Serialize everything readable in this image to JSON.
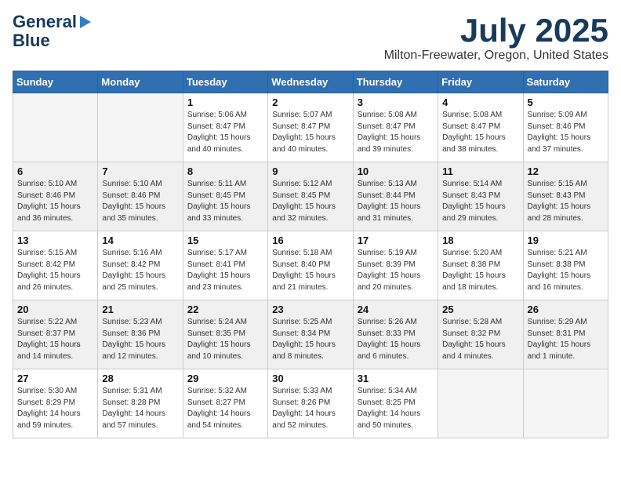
{
  "header": {
    "logo_line1": "General",
    "logo_line2": "Blue",
    "month": "July 2025",
    "location": "Milton-Freewater, Oregon, United States"
  },
  "weekdays": [
    "Sunday",
    "Monday",
    "Tuesday",
    "Wednesday",
    "Thursday",
    "Friday",
    "Saturday"
  ],
  "weeks": [
    [
      {
        "day": "",
        "detail": ""
      },
      {
        "day": "",
        "detail": ""
      },
      {
        "day": "1",
        "detail": "Sunrise: 5:06 AM\nSunset: 8:47 PM\nDaylight: 15 hours and 40 minutes."
      },
      {
        "day": "2",
        "detail": "Sunrise: 5:07 AM\nSunset: 8:47 PM\nDaylight: 15 hours and 40 minutes."
      },
      {
        "day": "3",
        "detail": "Sunrise: 5:08 AM\nSunset: 8:47 PM\nDaylight: 15 hours and 39 minutes."
      },
      {
        "day": "4",
        "detail": "Sunrise: 5:08 AM\nSunset: 8:47 PM\nDaylight: 15 hours and 38 minutes."
      },
      {
        "day": "5",
        "detail": "Sunrise: 5:09 AM\nSunset: 8:46 PM\nDaylight: 15 hours and 37 minutes."
      }
    ],
    [
      {
        "day": "6",
        "detail": "Sunrise: 5:10 AM\nSunset: 8:46 PM\nDaylight: 15 hours and 36 minutes."
      },
      {
        "day": "7",
        "detail": "Sunrise: 5:10 AM\nSunset: 8:46 PM\nDaylight: 15 hours and 35 minutes."
      },
      {
        "day": "8",
        "detail": "Sunrise: 5:11 AM\nSunset: 8:45 PM\nDaylight: 15 hours and 33 minutes."
      },
      {
        "day": "9",
        "detail": "Sunrise: 5:12 AM\nSunset: 8:45 PM\nDaylight: 15 hours and 32 minutes."
      },
      {
        "day": "10",
        "detail": "Sunrise: 5:13 AM\nSunset: 8:44 PM\nDaylight: 15 hours and 31 minutes."
      },
      {
        "day": "11",
        "detail": "Sunrise: 5:14 AM\nSunset: 8:43 PM\nDaylight: 15 hours and 29 minutes."
      },
      {
        "day": "12",
        "detail": "Sunrise: 5:15 AM\nSunset: 8:43 PM\nDaylight: 15 hours and 28 minutes."
      }
    ],
    [
      {
        "day": "13",
        "detail": "Sunrise: 5:15 AM\nSunset: 8:42 PM\nDaylight: 15 hours and 26 minutes."
      },
      {
        "day": "14",
        "detail": "Sunrise: 5:16 AM\nSunset: 8:42 PM\nDaylight: 15 hours and 25 minutes."
      },
      {
        "day": "15",
        "detail": "Sunrise: 5:17 AM\nSunset: 8:41 PM\nDaylight: 15 hours and 23 minutes."
      },
      {
        "day": "16",
        "detail": "Sunrise: 5:18 AM\nSunset: 8:40 PM\nDaylight: 15 hours and 21 minutes."
      },
      {
        "day": "17",
        "detail": "Sunrise: 5:19 AM\nSunset: 8:39 PM\nDaylight: 15 hours and 20 minutes."
      },
      {
        "day": "18",
        "detail": "Sunrise: 5:20 AM\nSunset: 8:38 PM\nDaylight: 15 hours and 18 minutes."
      },
      {
        "day": "19",
        "detail": "Sunrise: 5:21 AM\nSunset: 8:38 PM\nDaylight: 15 hours and 16 minutes."
      }
    ],
    [
      {
        "day": "20",
        "detail": "Sunrise: 5:22 AM\nSunset: 8:37 PM\nDaylight: 15 hours and 14 minutes."
      },
      {
        "day": "21",
        "detail": "Sunrise: 5:23 AM\nSunset: 8:36 PM\nDaylight: 15 hours and 12 minutes."
      },
      {
        "day": "22",
        "detail": "Sunrise: 5:24 AM\nSunset: 8:35 PM\nDaylight: 15 hours and 10 minutes."
      },
      {
        "day": "23",
        "detail": "Sunrise: 5:25 AM\nSunset: 8:34 PM\nDaylight: 15 hours and 8 minutes."
      },
      {
        "day": "24",
        "detail": "Sunrise: 5:26 AM\nSunset: 8:33 PM\nDaylight: 15 hours and 6 minutes."
      },
      {
        "day": "25",
        "detail": "Sunrise: 5:28 AM\nSunset: 8:32 PM\nDaylight: 15 hours and 4 minutes."
      },
      {
        "day": "26",
        "detail": "Sunrise: 5:29 AM\nSunset: 8:31 PM\nDaylight: 15 hours and 1 minute."
      }
    ],
    [
      {
        "day": "27",
        "detail": "Sunrise: 5:30 AM\nSunset: 8:29 PM\nDaylight: 14 hours and 59 minutes."
      },
      {
        "day": "28",
        "detail": "Sunrise: 5:31 AM\nSunset: 8:28 PM\nDaylight: 14 hours and 57 minutes."
      },
      {
        "day": "29",
        "detail": "Sunrise: 5:32 AM\nSunset: 8:27 PM\nDaylight: 14 hours and 54 minutes."
      },
      {
        "day": "30",
        "detail": "Sunrise: 5:33 AM\nSunset: 8:26 PM\nDaylight: 14 hours and 52 minutes."
      },
      {
        "day": "31",
        "detail": "Sunrise: 5:34 AM\nSunset: 8:25 PM\nDaylight: 14 hours and 50 minutes."
      },
      {
        "day": "",
        "detail": ""
      },
      {
        "day": "",
        "detail": ""
      }
    ]
  ]
}
